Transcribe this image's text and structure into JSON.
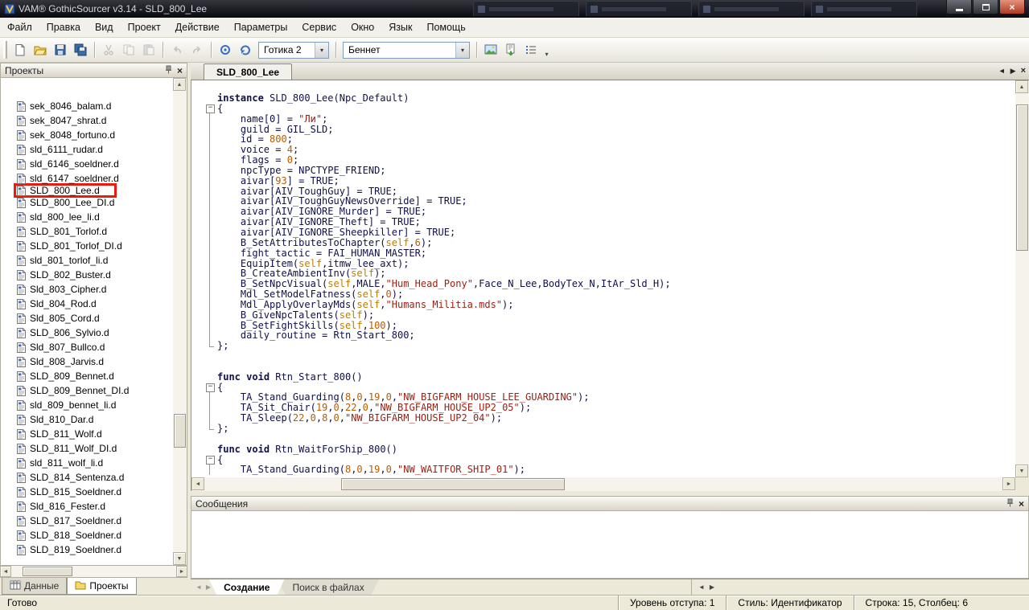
{
  "window": {
    "title": "VAM® GothicSourcer v3.14 - SLD_800_Lee"
  },
  "menu": {
    "items": [
      "Файл",
      "Правка",
      "Вид",
      "Проект",
      "Действие",
      "Параметры",
      "Сервис",
      "Окно",
      "Язык",
      "Помощь"
    ]
  },
  "toolbar": {
    "items": [
      {
        "type": "icon",
        "name": "new-file-icon"
      },
      {
        "type": "icon",
        "name": "open-folder-icon"
      },
      {
        "type": "icon",
        "name": "save-icon"
      },
      {
        "type": "icon",
        "name": "save-all-icon"
      },
      {
        "type": "sep"
      },
      {
        "type": "icon",
        "name": "cut-icon",
        "disabled": true
      },
      {
        "type": "icon",
        "name": "copy-icon",
        "disabled": true
      },
      {
        "type": "icon",
        "name": "paste-icon",
        "disabled": true
      },
      {
        "type": "sep"
      },
      {
        "type": "icon",
        "name": "undo-icon",
        "disabled": true
      },
      {
        "type": "icon",
        "name": "redo-icon",
        "disabled": true
      },
      {
        "type": "sep"
      },
      {
        "type": "icon",
        "name": "compile-scripts-icon"
      },
      {
        "type": "icon",
        "name": "decompile-icon"
      },
      {
        "type": "combo",
        "name": "game-version-select",
        "value": "Готика 2",
        "width": 88
      },
      {
        "type": "sep"
      },
      {
        "type": "combo",
        "name": "npc-select",
        "value": "Беннет",
        "width": 158
      },
      {
        "type": "sep"
      },
      {
        "type": "icon",
        "name": "window-image-icon"
      },
      {
        "type": "icon",
        "name": "export-item-icon"
      },
      {
        "type": "icon",
        "name": "details-list-icon"
      },
      {
        "type": "chevron",
        "name": "toolbar-overflow-icon"
      }
    ]
  },
  "projects_panel": {
    "title": "Проекты",
    "selected": "SLD_800_Lee.d",
    "files": [
      "sek_8046_balam.d",
      "sek_8047_shrat.d",
      "sek_8048_fortuno.d",
      "sld_6111_rudar.d",
      "sld_6146_soeldner.d",
      "sld_6147_soeldner.d",
      "SLD_800_Lee.d",
      "SLD_800_Lee_DI.d",
      "sld_800_lee_li.d",
      "SLD_801_Torlof.d",
      "SLD_801_Torlof_DI.d",
      "sld_801_torlof_li.d",
      "SLD_802_Buster.d",
      "Sld_803_Cipher.d",
      "Sld_804_Rod.d",
      "Sld_805_Cord.d",
      "SLD_806_Sylvio.d",
      "Sld_807_Bullco.d",
      "Sld_808_Jarvis.d",
      "SLD_809_Bennet.d",
      "SLD_809_Bennet_DI.d",
      "sld_809_bennet_li.d",
      "Sld_810_Dar.d",
      "SLD_811_Wolf.d",
      "SLD_811_Wolf_DI.d",
      "sld_811_wolf_li.d",
      "SLD_814_Sentenza.d",
      "SLD_815_Soeldner.d",
      "Sld_816_Fester.d",
      "SLD_817_Soeldner.d",
      "SLD_818_Soeldner.d",
      "SLD_819_Soeldner.d"
    ],
    "tabs": [
      {
        "label": "Данные",
        "icon": "data-table-icon",
        "active": false
      },
      {
        "label": "Проекты",
        "icon": "projects-folder-icon",
        "active": true
      }
    ]
  },
  "editor": {
    "tab": "SLD_800_Lee",
    "lines": [
      {
        "t": [
          [
            "k",
            "instance"
          ],
          [
            "p",
            " SLD_800_Lee(Npc_Default)"
          ]
        ]
      },
      {
        "g": "box",
        "t": [
          [
            "p",
            "{"
          ]
        ]
      },
      {
        "g": "vline",
        "t": [
          [
            "p",
            "    name[0] = "
          ],
          [
            "s",
            "\"Ли\""
          ],
          [
            "p",
            ";"
          ]
        ]
      },
      {
        "g": "vline",
        "t": [
          [
            "p",
            "    guild = GIL_SLD;"
          ]
        ]
      },
      {
        "g": "vline",
        "t": [
          [
            "p",
            "    id = "
          ],
          [
            "n",
            "800"
          ],
          [
            "p",
            ";"
          ]
        ]
      },
      {
        "g": "vline",
        "t": [
          [
            "p",
            "    voice = "
          ],
          [
            "n",
            "4"
          ],
          [
            "p",
            ";"
          ]
        ]
      },
      {
        "g": "vline",
        "t": [
          [
            "p",
            "    flags = "
          ],
          [
            "n",
            "0"
          ],
          [
            "p",
            ";"
          ]
        ]
      },
      {
        "g": "vline",
        "t": [
          [
            "p",
            "    npcType = NPCTYPE_FRIEND;"
          ]
        ]
      },
      {
        "g": "vline",
        "t": [
          [
            "p",
            "    aivar["
          ],
          [
            "n",
            "93"
          ],
          [
            "p",
            "] = TRUE;"
          ]
        ]
      },
      {
        "g": "vline",
        "t": [
          [
            "p",
            "    aivar[AIV_ToughGuy] = TRUE;"
          ]
        ]
      },
      {
        "g": "vline",
        "t": [
          [
            "p",
            "    aivar[AIV_ToughGuyNewsOverride] = TRUE;"
          ]
        ]
      },
      {
        "g": "vline",
        "t": [
          [
            "p",
            "    aivar[AIV_IGNORE_Murder] = TRUE;"
          ]
        ]
      },
      {
        "g": "vline",
        "t": [
          [
            "p",
            "    aivar[AIV_IGNORE_Theft] = TRUE;"
          ]
        ]
      },
      {
        "g": "vline",
        "t": [
          [
            "p",
            "    aivar[AIV_IGNORE_Sheepkiller] = TRUE;"
          ]
        ]
      },
      {
        "g": "vline",
        "t": [
          [
            "p",
            "    B_SetAttributesToChapter("
          ],
          [
            "f",
            "self"
          ],
          [
            "p",
            ","
          ],
          [
            "n",
            "6"
          ],
          [
            "p",
            ");"
          ]
        ]
      },
      {
        "g": "vline",
        "t": [
          [
            "p",
            "    fight_tactic = FAI_HUMAN_MASTER;"
          ]
        ]
      },
      {
        "g": "vline",
        "t": [
          [
            "p",
            "    EquipItem("
          ],
          [
            "f",
            "self"
          ],
          [
            "p",
            ",itmw_lee_axt);"
          ]
        ]
      },
      {
        "g": "vline",
        "t": [
          [
            "p",
            "    B_CreateAmbientInv("
          ],
          [
            "f",
            "self"
          ],
          [
            "p",
            ");"
          ]
        ]
      },
      {
        "g": "vline",
        "t": [
          [
            "p",
            "    B_SetNpcVisual("
          ],
          [
            "f",
            "self"
          ],
          [
            "p",
            ",MALE,"
          ],
          [
            "s",
            "\"Hum_Head_Pony\""
          ],
          [
            "p",
            ",Face_N_Lee,BodyTex_N,ItAr_Sld_H);"
          ]
        ]
      },
      {
        "g": "vline",
        "t": [
          [
            "p",
            "    Mdl_SetModelFatness("
          ],
          [
            "f",
            "self"
          ],
          [
            "p",
            ","
          ],
          [
            "n",
            "0"
          ],
          [
            "p",
            ");"
          ]
        ]
      },
      {
        "g": "vline",
        "t": [
          [
            "p",
            "    Mdl_ApplyOverlayMds("
          ],
          [
            "f",
            "self"
          ],
          [
            "p",
            ","
          ],
          [
            "s",
            "\"Humans_Militia.mds\""
          ],
          [
            "p",
            ");"
          ]
        ]
      },
      {
        "g": "vline",
        "t": [
          [
            "p",
            "    B_GiveNpcTalents("
          ],
          [
            "f",
            "self"
          ],
          [
            "p",
            ");"
          ]
        ]
      },
      {
        "g": "vline",
        "t": [
          [
            "p",
            "    B_SetFightSkills("
          ],
          [
            "f",
            "self"
          ],
          [
            "p",
            ","
          ],
          [
            "n",
            "100"
          ],
          [
            "p",
            ");"
          ]
        ]
      },
      {
        "g": "vline",
        "t": [
          [
            "p",
            "    daily_routine = Rtn_Start_800;"
          ]
        ]
      },
      {
        "g": "vend",
        "t": [
          [
            "p",
            "};"
          ]
        ]
      },
      {
        "t": []
      },
      {
        "t": []
      },
      {
        "t": [
          [
            "k",
            "func"
          ],
          [
            "p",
            " "
          ],
          [
            "k",
            "void"
          ],
          [
            "p",
            " Rtn_Start_800()"
          ]
        ]
      },
      {
        "g": "box",
        "t": [
          [
            "p",
            "{"
          ]
        ]
      },
      {
        "g": "vline",
        "t": [
          [
            "p",
            "    TA_Stand_Guarding("
          ],
          [
            "n",
            "8"
          ],
          [
            "p",
            ","
          ],
          [
            "n",
            "0"
          ],
          [
            "p",
            ","
          ],
          [
            "n",
            "19"
          ],
          [
            "p",
            ","
          ],
          [
            "n",
            "0"
          ],
          [
            "p",
            ","
          ],
          [
            "s",
            "\"NW_BIGFARM_HOUSE_LEE_GUARDING\""
          ],
          [
            "p",
            ");"
          ]
        ]
      },
      {
        "g": "vline",
        "t": [
          [
            "p",
            "    TA_Sit_Chair("
          ],
          [
            "n",
            "19"
          ],
          [
            "p",
            ","
          ],
          [
            "n",
            "0"
          ],
          [
            "p",
            ","
          ],
          [
            "n",
            "22"
          ],
          [
            "p",
            ","
          ],
          [
            "n",
            "0"
          ],
          [
            "p",
            ","
          ],
          [
            "s",
            "\"NW_BIGFARM_HOUSE_UP2_05\""
          ],
          [
            "p",
            ");"
          ]
        ]
      },
      {
        "g": "vline",
        "t": [
          [
            "p",
            "    TA_Sleep("
          ],
          [
            "n",
            "22"
          ],
          [
            "p",
            ","
          ],
          [
            "n",
            "0"
          ],
          [
            "p",
            ","
          ],
          [
            "n",
            "8"
          ],
          [
            "p",
            ","
          ],
          [
            "n",
            "0"
          ],
          [
            "p",
            ","
          ],
          [
            "s",
            "\"NW_BIGFARM_HOUSE_UP2_04\""
          ],
          [
            "p",
            ");"
          ]
        ]
      },
      {
        "g": "vend",
        "t": [
          [
            "p",
            "};"
          ]
        ]
      },
      {
        "t": []
      },
      {
        "t": [
          [
            "k",
            "func"
          ],
          [
            "p",
            " "
          ],
          [
            "k",
            "void"
          ],
          [
            "p",
            " Rtn_WaitForShip_800()"
          ]
        ]
      },
      {
        "g": "box",
        "t": [
          [
            "p",
            "{"
          ]
        ]
      },
      {
        "g": "vline",
        "t": [
          [
            "p",
            "    TA_Stand_Guarding("
          ],
          [
            "n",
            "8"
          ],
          [
            "p",
            ","
          ],
          [
            "n",
            "0"
          ],
          [
            "p",
            ","
          ],
          [
            "n",
            "19"
          ],
          [
            "p",
            ","
          ],
          [
            "n",
            "0"
          ],
          [
            "p",
            ","
          ],
          [
            "s",
            "\"NW_WAITFOR_SHIP_01\""
          ],
          [
            "p",
            ");"
          ]
        ]
      }
    ]
  },
  "messages_panel": {
    "title": "Сообщения"
  },
  "bottom_tabs": {
    "tabs": [
      {
        "label": "Создание",
        "active": true
      },
      {
        "label": "Поиск в файлах",
        "active": false
      }
    ]
  },
  "status_bar": {
    "ready": "Готово",
    "indent": "Уровень отступа: 1",
    "style": "Стиль: Идентификатор",
    "position": "Строка: 15, Столбец: 6"
  }
}
